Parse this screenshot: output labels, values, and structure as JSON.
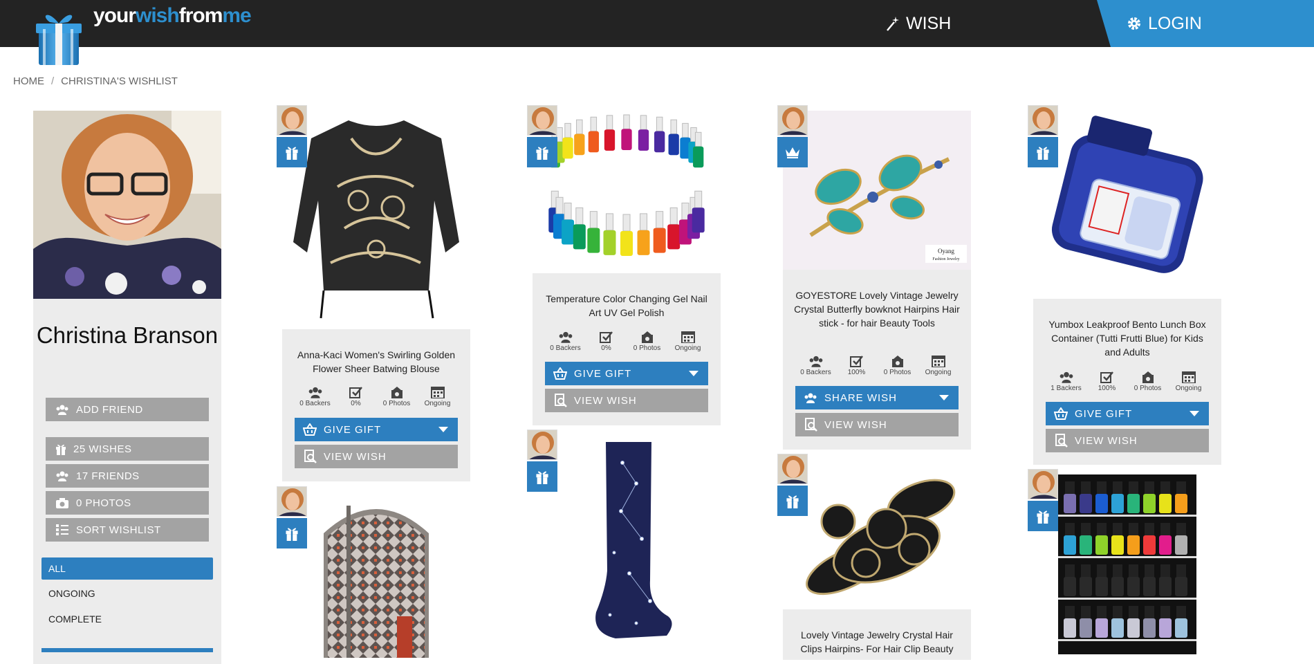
{
  "header": {
    "logo": {
      "part1": "your",
      "part2": "wish",
      "part3": "from",
      "part4": "me"
    },
    "nav_wish": "WISH",
    "nav_login": "LOGIN",
    "colors": {
      "bar": "#232323",
      "accent": "#2d8fce"
    }
  },
  "breadcrumb": {
    "home": "HOME",
    "separator": "/",
    "current": "CHRISTINA'S WISHLIST"
  },
  "profile": {
    "name": "Christina Branson",
    "add_friend": "ADD FRIEND",
    "wishes": "25 WISHES",
    "friends": "17 FRIENDS",
    "photos": "0 PHOTOS",
    "sort": "SORT WISHLIST",
    "filters": [
      "ALL",
      "ONGOING",
      "COMPLETE"
    ]
  },
  "cards": [
    {
      "title": "Anna-Kaci Women's Swirling Golden Flower Sheer Batwing Blouse",
      "backers": "0 Backers",
      "progress": "0%",
      "photos": "0 Photos",
      "status": "Ongoing",
      "action": "GIVE GIFT",
      "view": "VIEW WISH",
      "badge_icon": "gift-icon"
    },
    {
      "title": "Temperature Color Changing Gel Nail Art UV Gel Polish",
      "backers": "0 Backers",
      "progress": "0%",
      "photos": "0 Photos",
      "status": "Ongoing",
      "action": "GIVE GIFT",
      "view": "VIEW WISH",
      "badge_icon": "gift-icon"
    },
    {
      "title": "GOYESTORE Lovely Vintage Jewelry Crystal Butterfly bowknot Hairpins Hair stick - for hair Beauty Tools",
      "backers": "0 Backers",
      "progress": "100%",
      "photos": "0 Photos",
      "status": "Ongoing",
      "action": "SHARE WISH",
      "view": "VIEW WISH",
      "badge_icon": "crown-icon",
      "image_caption": {
        "brand": "Oyang",
        "sub": "Fashion Jewelry"
      }
    },
    {
      "title": "Yumbox Leakproof Bento Lunch Box Container (Tutti Frutti Blue) for Kids and Adults",
      "backers": "1 Backers",
      "progress": "100%",
      "photos": "0 Photos",
      "status": "Ongoing",
      "action": "GIVE GIFT",
      "view": "VIEW WISH",
      "badge_icon": "gift-icon"
    },
    {
      "title": "",
      "badge_icon": "gift-icon"
    },
    {
      "title": "",
      "badge_icon": "gift-icon"
    },
    {
      "title": "Lovely Vintage Jewelry Crystal Hair Clips Hairpins- For Hair Clip Beauty",
      "badge_icon": "gift-icon"
    },
    {
      "title": "",
      "badge_icon": "gift-icon"
    }
  ]
}
